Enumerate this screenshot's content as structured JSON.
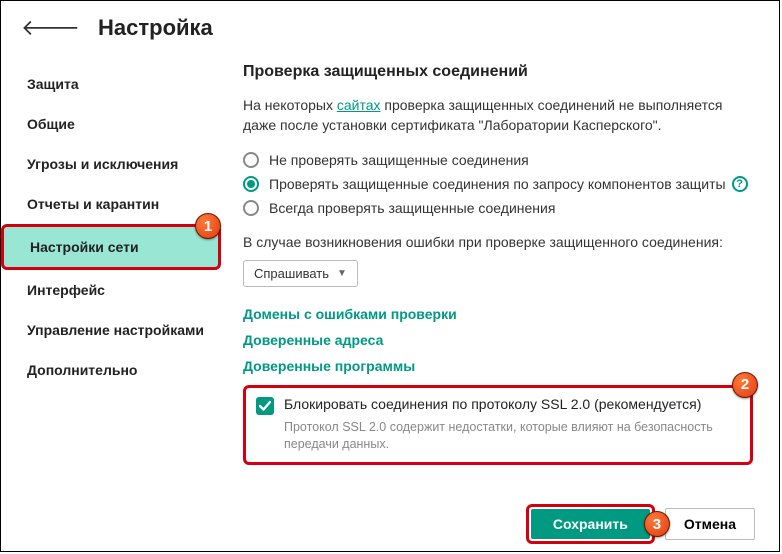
{
  "header": {
    "title": "Настройка"
  },
  "sidebar": {
    "items": [
      {
        "label": "Защита"
      },
      {
        "label": "Общие"
      },
      {
        "label": "Угрозы и исключения"
      },
      {
        "label": "Отчеты и карантин"
      },
      {
        "label": "Настройки сети"
      },
      {
        "label": "Интерфейс"
      },
      {
        "label": "Управление настройками"
      },
      {
        "label": "Дополнительно"
      }
    ]
  },
  "content": {
    "section_title": "Проверка защищенных соединений",
    "desc_pre": "На некоторых ",
    "desc_link": "сайтах",
    "desc_post": " проверка защищенных соединений не выполняется даже после установки сертификата \"Лаборатории Касперского\".",
    "radios": [
      {
        "label": "Не проверять защищенные соединения"
      },
      {
        "label": "Проверять защищенные соединения по запросу компонентов защиты"
      },
      {
        "label": "Всегда проверять защищенные соединения"
      }
    ],
    "error_label": "В случае возникновения ошибки при проверке защищенного соединения:",
    "dropdown_value": "Спрашивать",
    "links": [
      "Домены с ошибками проверки",
      "Доверенные адреса",
      "Доверенные программы"
    ],
    "checkbox_label": "Блокировать соединения по протоколу SSL 2.0 (рекомендуется)",
    "checkbox_desc": "Протокол SSL 2.0 содержит недостатки, которые влияют на безопасность передачи данных."
  },
  "footer": {
    "save": "Сохранить",
    "cancel": "Отмена"
  },
  "badges": {
    "b1": "1",
    "b2": "2",
    "b3": "3"
  }
}
